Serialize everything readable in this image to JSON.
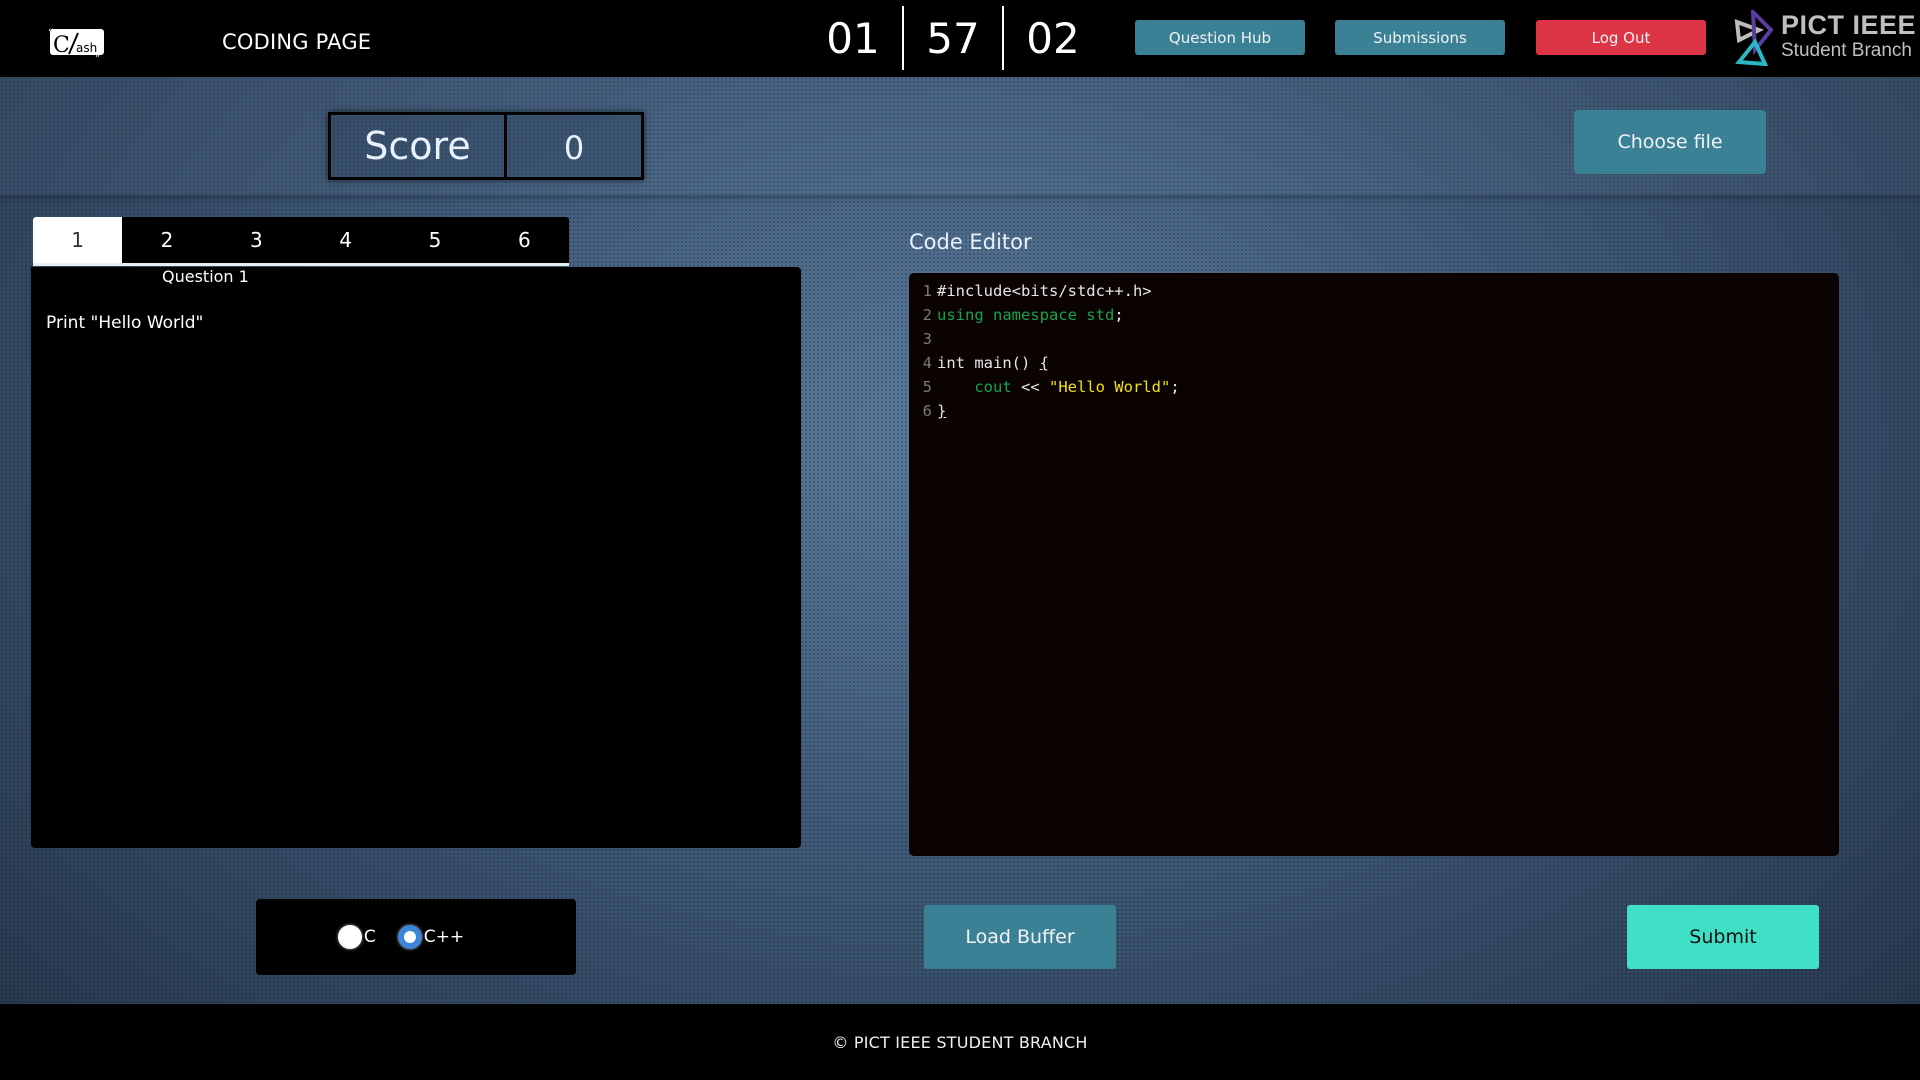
{
  "header": {
    "logo_text_main": "C",
    "logo_text_sub": "ash",
    "page_title": "CODING PAGE",
    "timer": {
      "hours": "01",
      "minutes": "57",
      "seconds": "02"
    },
    "buttons": {
      "question_hub": "Question Hub",
      "submissions": "Submissions",
      "log_out": "Log Out"
    },
    "branch_logo": {
      "line1": "PICT IEEE",
      "line2": "Student Branch"
    }
  },
  "score": {
    "label": "Score",
    "value": "0"
  },
  "choose_file_label": "Choose file",
  "question_tabs": {
    "active": "1",
    "tabs": [
      "1",
      "2",
      "3",
      "4",
      "5",
      "6"
    ]
  },
  "question": {
    "title": "Question 1",
    "text": "Print \"Hello World\""
  },
  "editor": {
    "label": "Code Editor",
    "lines": [
      {
        "n": "1",
        "tokens": [
          {
            "t": "#include<bits/stdc++.h>",
            "c": "plain"
          }
        ]
      },
      {
        "n": "2",
        "tokens": [
          {
            "t": "using namespace std",
            "c": "kw-green"
          },
          {
            "t": ";",
            "c": "plain"
          }
        ]
      },
      {
        "n": "3",
        "tokens": []
      },
      {
        "n": "4",
        "tokens": [
          {
            "t": "int main() ",
            "c": "plain"
          },
          {
            "t": "{",
            "c": "plain brace-ul"
          }
        ]
      },
      {
        "n": "5",
        "tokens": [
          {
            "t": "    ",
            "c": "plain"
          },
          {
            "t": "cout",
            "c": "kw-green"
          },
          {
            "t": " << ",
            "c": "plain"
          },
          {
            "t": "\"Hello World\"",
            "c": "str"
          },
          {
            "t": ";",
            "c": "plain"
          }
        ]
      },
      {
        "n": "6",
        "tokens": [
          {
            "t": "}",
            "c": "plain brace-ul"
          }
        ]
      }
    ]
  },
  "language": {
    "options": [
      {
        "label": "C",
        "checked": false
      },
      {
        "label": "C++",
        "checked": true
      }
    ]
  },
  "actions": {
    "load_buffer": "Load Buffer",
    "submit": "Submit"
  },
  "footer": {
    "text": "© PICT IEEE STUDENT BRANCH"
  },
  "colors": {
    "teal_button": "#3b8196",
    "logout_red": "#dd3545",
    "submit_aqua": "#3fe0c5",
    "radio_blue": "#3c86d8"
  }
}
